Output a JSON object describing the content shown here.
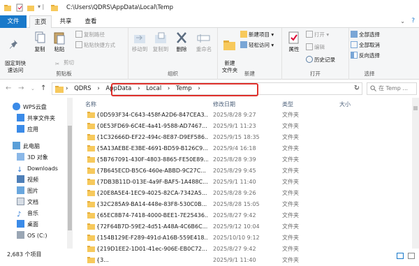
{
  "titlebar": {
    "path": "C:\\Users\\QDRS\\AppData\\Local\\Temp"
  },
  "tabs": {
    "file": "文件",
    "home": "主页",
    "share": "共享",
    "view": "查看"
  },
  "ribbon": {
    "pin_label": "固定到快\n速访问",
    "copy_label": "复制",
    "paste_label": "粘贴",
    "cut_label": "剪切",
    "copy_path_label": "复制路径",
    "paste_shortcut_label": "粘贴快捷方式",
    "clipboard_group": "剪贴板",
    "move_to_label": "移动到",
    "copy_to_label": "复制到",
    "delete_label": "删除",
    "rename_label": "重命名",
    "organize_group": "组织",
    "new_folder_label": "新建\n文件夹",
    "new_item_label": "新建项目 ▾",
    "easy_access_label": "轻松访问 ▾",
    "new_group": "新建",
    "properties_label": "属性",
    "open_label": "打开 ▾",
    "edit_label": "编辑",
    "history_label": "历史记录",
    "open_group": "打开",
    "select_all_label": "全部选择",
    "select_none_label": "全部取消",
    "invert_label": "反向选择",
    "select_group": "选择"
  },
  "address": {
    "crumbs": [
      "QDRS",
      "AppData",
      "Local",
      "Temp"
    ],
    "search_placeholder": "在 Temp ..."
  },
  "nav": {
    "items": [
      "WPS云盘",
      "共享文件夹",
      "应用",
      "此电脑",
      "3D 对象",
      "Downloads",
      "视频",
      "图片",
      "文档",
      "音乐",
      "桌面",
      "OS (C:)"
    ]
  },
  "list": {
    "headers": {
      "name": "名称",
      "date": "修改日期",
      "type": "类型",
      "size": "大小"
    },
    "rows": [
      {
        "name": "{0D593F34-C643-458f-A2D6-847CEA3...",
        "date": "2025/8/28 9:27",
        "type": "文件夹"
      },
      {
        "name": "{0E53FD69-6C4E-4a41-9588-AD7467...",
        "date": "2025/9/1 11:23",
        "type": "文件夹"
      },
      {
        "name": "{1C32666D-EF22-494c-8E87-D9EF586...",
        "date": "2025/9/15 18:35",
        "type": "文件夹"
      },
      {
        "name": "{5A13AEBE-E3BE-4691-BD59-B126C9...",
        "date": "2025/9/4 16:18",
        "type": "文件夹"
      },
      {
        "name": "{5B767091-430F-4803-8865-FE50E89...",
        "date": "2025/8/28 9:39",
        "type": "文件夹"
      },
      {
        "name": "{7B645ECD-B5C6-460e-ABBD-9C27C...",
        "date": "2025/8/29 9:45",
        "type": "文件夹"
      },
      {
        "name": "{7DB3B11D-013E-4a9F-BAF5-1A488C...",
        "date": "2025/9/1 11:40",
        "type": "文件夹"
      },
      {
        "name": "{20E8A5E4-1EC9-4025-82CA-7342A5...",
        "date": "2025/8/28 9:26",
        "type": "文件夹"
      },
      {
        "name": "{32C285A9-BA14-448e-83F8-530C0B...",
        "date": "2025/8/28 15:05",
        "type": "文件夹"
      },
      {
        "name": "{65EC8B74-7418-4000-BEE1-7E25436...",
        "date": "2025/8/27 9:42",
        "type": "文件夹"
      },
      {
        "name": "{72F64B7D-59E2-4d51-A48A-4C6B6C...",
        "date": "2025/9/12 10:04",
        "type": "文件夹"
      },
      {
        "name": "{154B129E-F289-491d-A16B-559E418...",
        "date": "2025/10/10 9:12",
        "type": "文件夹"
      },
      {
        "name": "{219D1EE2-1D01-41ec-906E-EB0C72...",
        "date": "2025/8/27 9:42",
        "type": "文件夹"
      },
      {
        "name": "{3...",
        "date": "2025/9/1 11:40",
        "type": "文件夹"
      }
    ]
  },
  "status": {
    "count": "2,683 个项目"
  },
  "colors": {
    "accent": "#1979ca",
    "highlight": "#e0302b",
    "folder": "#f7c95c"
  }
}
